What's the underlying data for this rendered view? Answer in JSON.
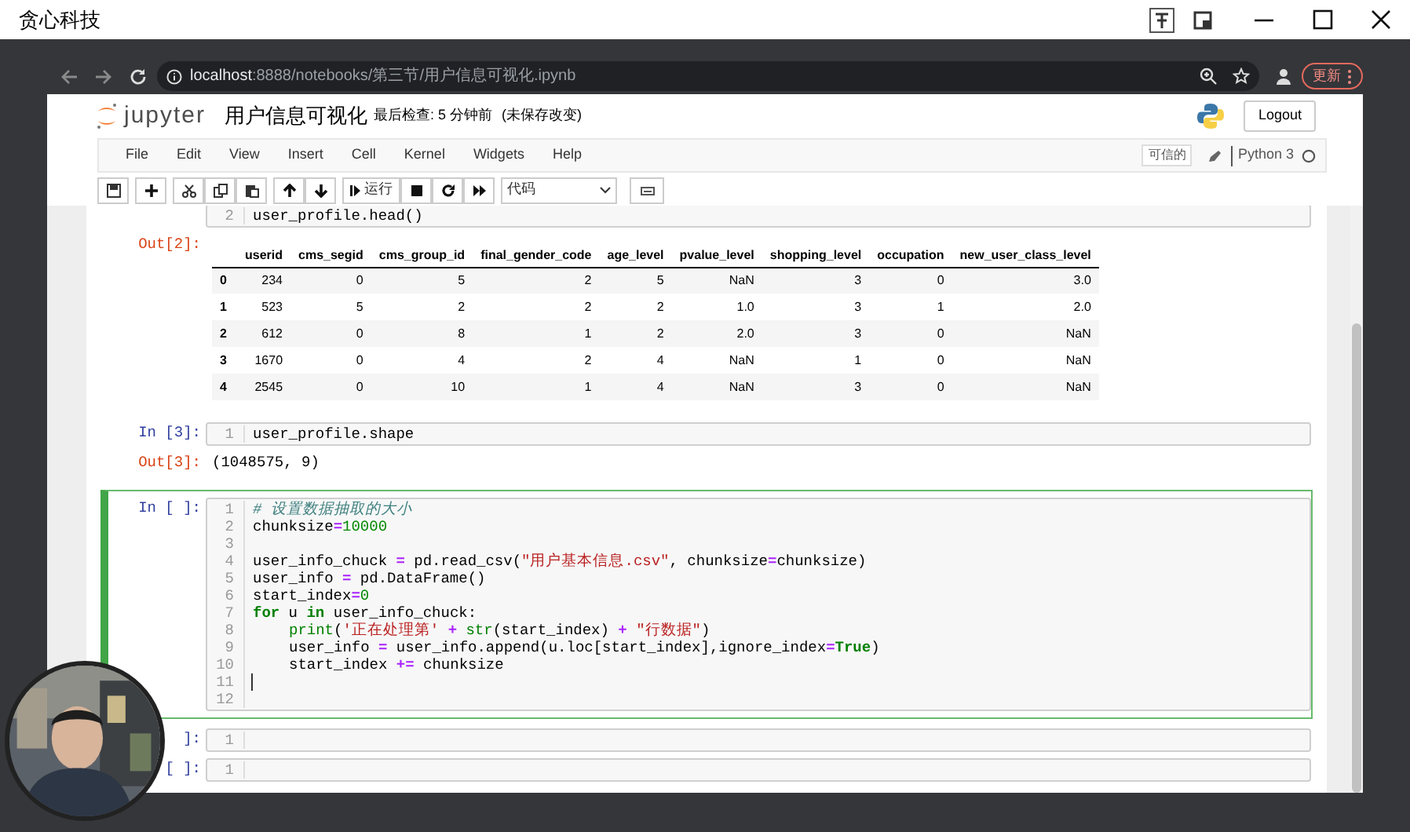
{
  "window": {
    "title": "贪心科技"
  },
  "browser": {
    "url_host": "localhost",
    "url_path": ":8888/notebooks/第三节/用户信息可视化.ipynb",
    "update_button": "更新"
  },
  "header": {
    "logo_text": "jupyter",
    "notebook_title": "用户信息可视化",
    "last_checkpoint": "最后检查: 5 分钟前",
    "unsaved": "(未保存改变)",
    "logout": "Logout"
  },
  "menu": [
    "File",
    "Edit",
    "View",
    "Insert",
    "Cell",
    "Kernel",
    "Widgets",
    "Help"
  ],
  "trusted": "可信的",
  "kernel": "Python 3",
  "kernel_busy": false,
  "toolbar": {
    "run_label": "运行",
    "cell_type": "代码"
  },
  "cells": [
    {
      "kind": "code",
      "selected": false,
      "lines": [
        {
          "number": "2",
          "cursor": false,
          "tokens": [
            {
              "kind": "plain",
              "text": "user_profile.head()"
            }
          ]
        }
      ]
    },
    {
      "kind": "table",
      "selected": false,
      "prompt": "Out[2]:",
      "columns": [
        "userid",
        "cms_segid",
        "cms_group_id",
        "final_gender_code",
        "age_level",
        "pvalue_level",
        "shopping_level",
        "occupation",
        "new_user_class_level"
      ],
      "rows": [
        {
          "index": "0",
          "cells": [
            "234",
            "0",
            "5",
            "2",
            "5",
            "NaN",
            "3",
            "0",
            "3.0"
          ]
        },
        {
          "index": "1",
          "cells": [
            "523",
            "5",
            "2",
            "2",
            "2",
            "1.0",
            "3",
            "1",
            "2.0"
          ]
        },
        {
          "index": "2",
          "cells": [
            "612",
            "0",
            "8",
            "1",
            "2",
            "2.0",
            "3",
            "0",
            "NaN"
          ]
        },
        {
          "index": "3",
          "cells": [
            "1670",
            "0",
            "4",
            "2",
            "4",
            "NaN",
            "1",
            "0",
            "NaN"
          ]
        },
        {
          "index": "4",
          "cells": [
            "2545",
            "0",
            "10",
            "1",
            "4",
            "NaN",
            "3",
            "0",
            "NaN"
          ]
        }
      ]
    },
    {
      "kind": "code",
      "selected": false,
      "prompt": "In [3]:",
      "lines": [
        {
          "number": "1",
          "cursor": false,
          "tokens": [
            {
              "kind": "plain",
              "text": "user_profile.shape"
            }
          ]
        }
      ]
    },
    {
      "kind": "text",
      "selected": false,
      "prompt": "Out[3]:",
      "text": "(1048575, 9)"
    },
    {
      "kind": "code",
      "selected": true,
      "prompt": "In [ ]:",
      "lines": [
        {
          "number": "1",
          "cursor": false,
          "tokens": [
            {
              "kind": "comment",
              "text": "# 设置数据抽取的大小"
            }
          ]
        },
        {
          "number": "2",
          "cursor": false,
          "tokens": [
            {
              "kind": "plain",
              "text": "chunksize"
            },
            {
              "kind": "operator",
              "text": "="
            },
            {
              "kind": "number",
              "text": "10000"
            }
          ]
        },
        {
          "number": "3",
          "cursor": false
        },
        {
          "number": "4",
          "cursor": false,
          "tokens": [
            {
              "kind": "plain",
              "text": "user_info_chuck "
            },
            {
              "kind": "operator",
              "text": "="
            },
            {
              "kind": "plain",
              "text": " pd.read_csv("
            },
            {
              "kind": "string",
              "text": "\"用户基本信息.csv\""
            },
            {
              "kind": "plain",
              "text": ", chunksize"
            },
            {
              "kind": "operator",
              "text": "="
            },
            {
              "kind": "plain",
              "text": "chunksize)"
            }
          ]
        },
        {
          "number": "5",
          "cursor": false,
          "tokens": [
            {
              "kind": "plain",
              "text": "user_info "
            },
            {
              "kind": "operator",
              "text": "="
            },
            {
              "kind": "plain",
              "text": " pd.DataFrame()"
            }
          ]
        },
        {
          "number": "6",
          "cursor": false,
          "tokens": [
            {
              "kind": "plain",
              "text": "start_index"
            },
            {
              "kind": "operator",
              "text": "="
            },
            {
              "kind": "number",
              "text": "0"
            }
          ]
        },
        {
          "number": "7",
          "cursor": false,
          "tokens": [
            {
              "kind": "keyword",
              "text": "for"
            },
            {
              "kind": "plain",
              "text": " u "
            },
            {
              "kind": "keyword",
              "text": "in"
            },
            {
              "kind": "plain",
              "text": " user_info_chuck:"
            }
          ]
        },
        {
          "number": "8",
          "cursor": false,
          "indented": true,
          "tokens": [
            {
              "kind": "builtin",
              "text": "print"
            },
            {
              "kind": "plain",
              "text": "("
            },
            {
              "kind": "string",
              "text": "'正在处理第'"
            },
            {
              "kind": "operator",
              "text": " + "
            },
            {
              "kind": "builtin",
              "text": "str"
            },
            {
              "kind": "plain",
              "text": "(start_index)"
            },
            {
              "kind": "operator",
              "text": " + "
            },
            {
              "kind": "string",
              "text": "\"行数据\""
            },
            {
              "kind": "plain",
              "text": ")"
            }
          ]
        },
        {
          "number": "9",
          "cursor": false,
          "indented": true,
          "tokens": [
            {
              "kind": "plain",
              "text": "user_info "
            },
            {
              "kind": "operator",
              "text": "="
            },
            {
              "kind": "plain",
              "text": " user_info.append(u.loc[start_index],ignore_index"
            },
            {
              "kind": "operator",
              "text": "="
            },
            {
              "kind": "keyword",
              "text": "True"
            },
            {
              "kind": "plain",
              "text": ")"
            }
          ]
        },
        {
          "number": "10",
          "cursor": false,
          "indented": true,
          "tokens": [
            {
              "kind": "plain",
              "text": "start_index "
            },
            {
              "kind": "operator",
              "text": "+="
            },
            {
              "kind": "plain",
              "text": " chunksize"
            }
          ]
        },
        {
          "number": "11",
          "cursor": true
        },
        {
          "number": "12",
          "cursor": false
        }
      ]
    },
    {
      "kind": "code",
      "selected": false,
      "prompt": "]:",
      "lines": [
        {
          "number": "1",
          "cursor": false
        }
      ]
    },
    {
      "kind": "code",
      "selected": false,
      "prompt": "[ ]:",
      "lines": [
        {
          "number": "1",
          "cursor": false
        }
      ]
    }
  ],
  "webcam": {
    "kind": "picture"
  }
}
